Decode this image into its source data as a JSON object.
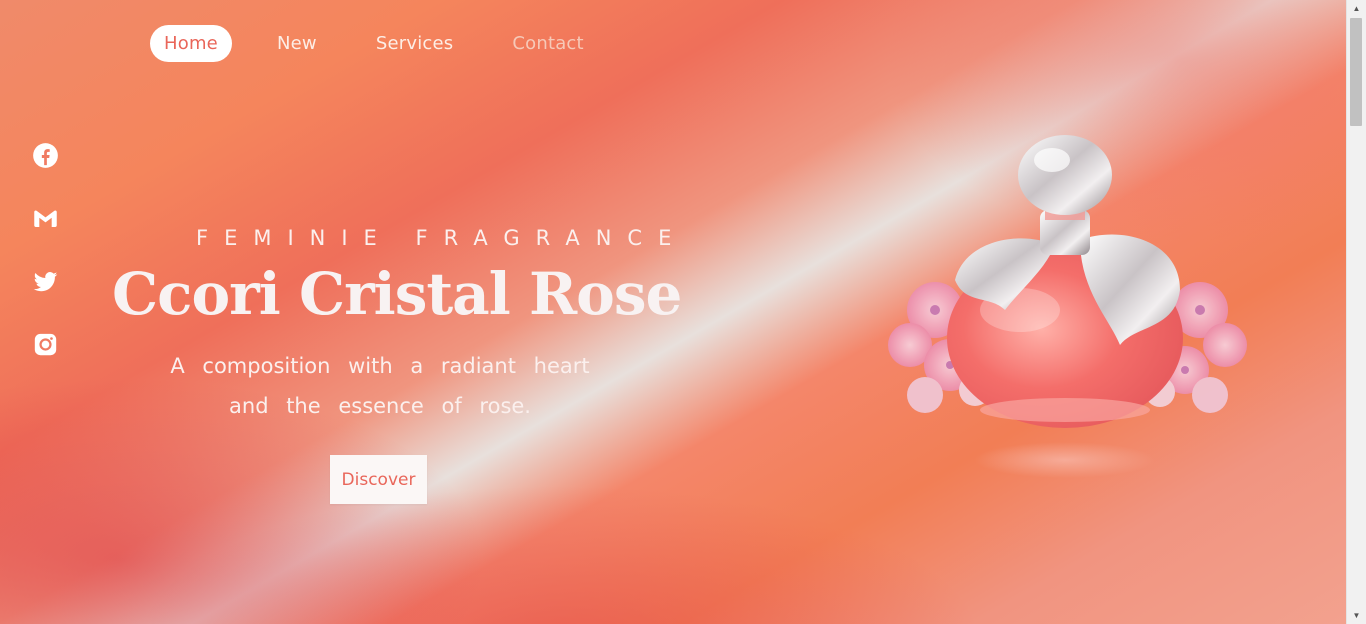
{
  "nav": {
    "items": [
      {
        "label": "Home",
        "active": true
      },
      {
        "label": "New"
      },
      {
        "label": "Services"
      },
      {
        "label": "Contact"
      }
    ]
  },
  "social": {
    "icons": [
      "facebook-icon",
      "gmail-icon",
      "twitter-icon",
      "instagram-icon"
    ]
  },
  "hero": {
    "eyebrow": "FEMINIE FRAGRANCE",
    "title": "Ccori Cristal Rose",
    "subtitle_line1": "A composition with a radiant heart",
    "subtitle_line2": "and the essence of rose.",
    "cta_label": "Discover"
  },
  "colors": {
    "accent": "#e9665a",
    "text_light": "#fbf0ee",
    "button_bg": "#fbf7f6"
  }
}
